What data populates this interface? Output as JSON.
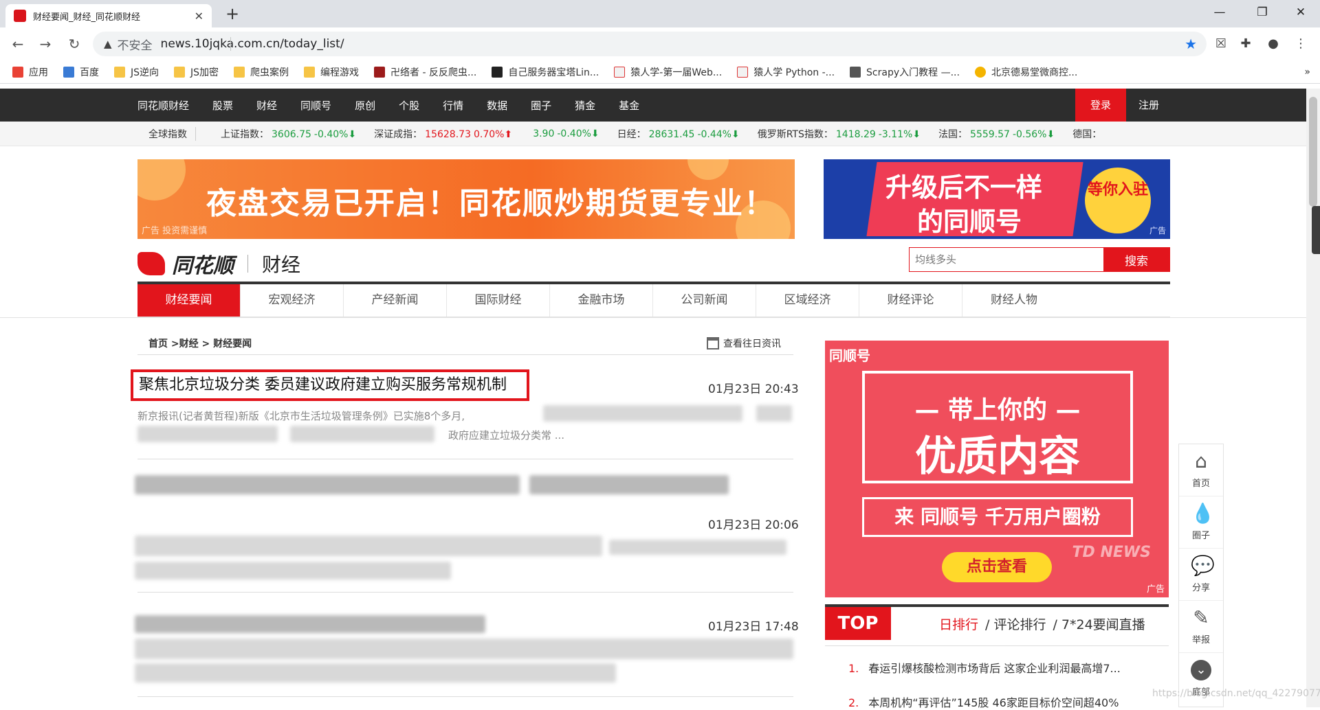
{
  "browser": {
    "tab_title": "财经要闻_财经_同花顺财经",
    "new_tab": "+",
    "url": "news.10jqka.com.cn/today_list/",
    "security": "不安全",
    "bookmarks": [
      "应用",
      "百度",
      "JS逆向",
      "JS加密",
      "爬虫案例",
      "编程游戏",
      "卍络者 - 反反爬虫...",
      "自己服务器宝塔Lin...",
      "猿人学-第一届Web...",
      "猿人学 Python -...",
      "Scrapy入门教程 —...",
      "北京德易堂微商控..."
    ],
    "bookmarks_more": "»"
  },
  "site": {
    "nav": [
      "同花顺财经",
      "股票",
      "财经",
      "同顺号",
      "原创",
      "个股",
      "行情",
      "数据",
      "圈子",
      "猜金",
      "基金"
    ],
    "login": "登录",
    "register": "注册",
    "ticker_label": "全球指数",
    "ticker": [
      {
        "name": "上证指数：",
        "value": "3606.75",
        "change": "-0.40%",
        "dir": "down"
      },
      {
        "name": "深证成指：",
        "value": "15628.73",
        "change": "0.70%",
        "dir": "up"
      },
      {
        "name": "",
        "value": "3.90",
        "change": "-0.40%",
        "dir": "down"
      },
      {
        "name": "日经：",
        "value": "28631.45",
        "change": "-0.44%",
        "dir": "down"
      },
      {
        "name": "俄罗斯RTS指数：",
        "value": "1418.29",
        "change": "-3.11%",
        "dir": "down"
      },
      {
        "name": "法国：",
        "value": "5559.57",
        "change": "-0.56%",
        "dir": "down"
      },
      {
        "name": "德国：",
        "value": "",
        "change": "",
        "dir": ""
      }
    ],
    "ad_left_text": "夜盘交易已开启！同花顺炒期货更专业！",
    "ad_left_tag": "广告 投资需谨慎",
    "ad_right_line1": "升级后不一样",
    "ad_right_line2": "的同顺号",
    "ad_right_circle": "等你入驻",
    "ad_tag": "广告",
    "logo_brand": "同花顺",
    "logo_sub": "财经",
    "search_placeholder": "均线多头",
    "search_button": "搜索",
    "categories": [
      "财经要闻",
      "宏观经济",
      "产经新闻",
      "国际财经",
      "金融市场",
      "公司新闻",
      "区域经济",
      "财经评论",
      "财经人物"
    ]
  },
  "content": {
    "breadcrumb": "首页 >财经 > 财经要闻",
    "history_link": "查看往日资讯",
    "news": [
      {
        "title": "聚焦北京垃圾分类 委员建议政府建立购买服务常规机制",
        "time": "01月23日 20:43",
        "summary_start": "新京报讯(记者黄哲程)新版《北京市生活垃圾管理条例》已实施8个多月,",
        "summary_end": "政府应建立垃圾分类常 ..."
      },
      {
        "title": "",
        "time": "01月23日 20:06"
      },
      {
        "title": "",
        "time": "01月23日 17:48"
      }
    ]
  },
  "sidebar": {
    "promo_brand": "同顺号",
    "promo_line1": "— 带上你的 —",
    "promo_line2": "优质内容",
    "promo_line3": "来 同顺号 千万用户圈粉",
    "promo_cta": "点击查看",
    "promo_bg_text": "TD NEWS",
    "top_label": "TOP",
    "top_tabs": [
      "日排行",
      "/ 评论排行",
      "/ 7*24要闻直播"
    ],
    "ranks": [
      {
        "n": "1.",
        "text": "春运引爆核酸检测市场背后 这家企业利润最高增7..."
      },
      {
        "n": "2.",
        "text": "本周机构“再评估”145股 46家距目标价空间超40%"
      }
    ]
  },
  "tools": [
    {
      "label": "首页",
      "icon": "home-icon"
    },
    {
      "label": "圈子",
      "icon": "drop-icon"
    },
    {
      "label": "分享",
      "icon": "chat-icon"
    },
    {
      "label": "举报",
      "icon": "edit-icon"
    },
    {
      "label": "底部",
      "icon": "chevron-down-icon"
    }
  ],
  "watermark": "https://blog.csdn.net/qq_42279077",
  "colors": {
    "brand_red": "#e2151c",
    "nav_dark": "#2d2d2d",
    "up": "#e2151c",
    "down": "#1a9c3e"
  }
}
